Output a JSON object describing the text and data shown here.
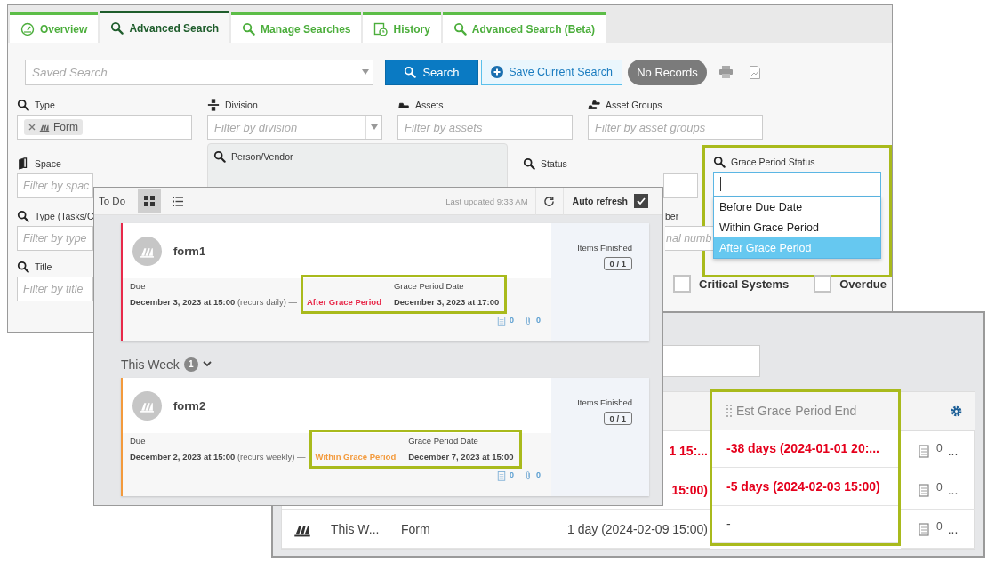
{
  "search_window": {
    "tabs": [
      {
        "label": "Overview",
        "selected": false
      },
      {
        "label": "Advanced Search",
        "selected": true
      },
      {
        "label": "Manage Searches",
        "selected": false
      },
      {
        "label": "History",
        "selected": false
      },
      {
        "label": "Advanced Search (Beta)",
        "selected": false
      }
    ],
    "saved_search": {
      "placeholder": "Saved Search"
    },
    "search_button": "Search",
    "save_button": "Save Current Search",
    "records_badge": "No Records",
    "filters": [
      [
        {
          "kind": "field",
          "label": "Type",
          "tags": [
            "Form"
          ]
        },
        {
          "kind": "select",
          "label": "Division",
          "placeholder": "Filter by division"
        },
        {
          "kind": "field",
          "label": "Assets",
          "placeholder": "Filter by assets"
        },
        {
          "kind": "field",
          "label": "Asset Groups",
          "placeholder": "Filter by asset groups"
        }
      ],
      [
        {
          "kind": "short",
          "label": "Space",
          "placeholder": "Filter by spac"
        },
        {
          "kind": "panel",
          "label": "Person/Vendor"
        },
        {
          "kind": "hidden",
          "label": "Status"
        },
        {
          "kind": "open",
          "label": "Grace Period Status",
          "highlighted": true,
          "options": [
            {
              "label": "Before Due Date",
              "selected": false
            },
            {
              "label": "Within Grace Period",
              "selected": false
            },
            {
              "label": "After Grace Period",
              "selected": true
            }
          ]
        }
      ],
      [
        {
          "kind": "short",
          "label": "Type (Tasks/C",
          "placeholder": "Filter by type"
        },
        {
          "kind": "cut",
          "label": "ber",
          "placeholder": "nal numb"
        }
      ],
      [
        {
          "kind": "short",
          "label": "Title",
          "placeholder": "Filter by title"
        },
        {
          "kind": "checkbox",
          "label": "Critical Systems",
          "checked": false
        },
        {
          "kind": "checkbox",
          "label": "Overdue",
          "checked": false
        }
      ]
    ]
  },
  "results_window": {
    "header": "Est Grace Period End",
    "highlighted": true,
    "rows": [
      {
        "due": "1 15:...",
        "est": "-38 days (2024-01-01 20:...",
        "notes": "0",
        "more": "...",
        "overdue": true
      },
      {
        "due": "15:00)",
        "est": "-5 days (2024-02-03 15:00)",
        "notes": "0",
        "more": "...",
        "overdue": true
      },
      {
        "title": "This W...",
        "type": "Form",
        "due": "1 day (2024-02-09 15:00)",
        "est": "-",
        "notes": "0",
        "more": "...",
        "overdue": false
      }
    ]
  },
  "todo_window": {
    "title": "To Do",
    "views": [
      {
        "kind": "grid",
        "selected": true
      },
      {
        "kind": "list",
        "selected": false
      }
    ],
    "updated": "Last updated 9:33 AM",
    "auto_refresh": {
      "label": "Auto refresh",
      "checked": true
    },
    "groups": [
      {
        "cards": [
          {
            "name": "form1",
            "color": "#e8294a",
            "due_label": "Due",
            "due": "December 3, 2023 at 15:00",
            "recurs": "(recurs daily) —",
            "status": "After Grace Period",
            "grace_label": "Grace Period Date",
            "grace_date": "December 3, 2023 at 17:00",
            "highlighted": true,
            "notes": "0",
            "attachments": "0",
            "items_label": "Items Finished",
            "items": "0 / 1"
          }
        ]
      },
      {
        "title": "This Week",
        "count": "1",
        "cards": [
          {
            "name": "form2",
            "color": "#f39a3c",
            "due_label": "Due",
            "due": "December 2, 2023 at 15:00",
            "recurs": "(recurs weekly) —",
            "status": "Within Grace Period",
            "grace_label": "Grace Period Date",
            "grace_date": "December 7, 2023 at 15:00",
            "highlighted": true,
            "notes": "0",
            "attachments": "0",
            "items_label": "Items Finished",
            "items": "0 / 1"
          }
        ]
      }
    ]
  }
}
